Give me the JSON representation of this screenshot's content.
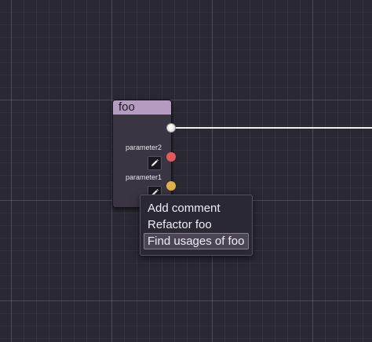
{
  "node": {
    "title": "foo",
    "header_color": "#b59bbf",
    "parameters": [
      {
        "label": "parameter2",
        "edit_icon": "pencil-icon",
        "port_color": "#e35a5a"
      },
      {
        "label": "parameter1",
        "edit_icon": "pencil-icon",
        "port_color": "#e0b04a"
      }
    ],
    "output_port_color": "#f0f0f0"
  },
  "context_menu": {
    "items": [
      {
        "label": "Add comment"
      },
      {
        "label": "Refactor foo"
      },
      {
        "label": "Find usages of foo",
        "selected": true
      }
    ]
  },
  "colors": {
    "background": "#2a2833",
    "wire": "#f0f0f0",
    "menu_highlight": "#4a4654"
  }
}
